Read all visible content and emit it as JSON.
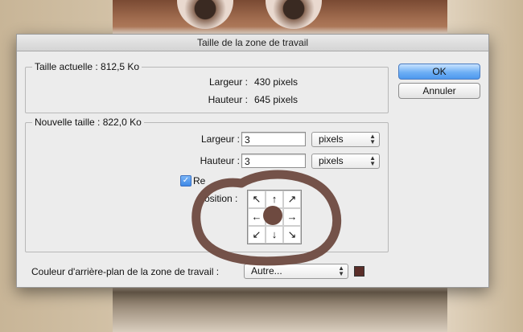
{
  "dialog": {
    "title": "Taille de la zone de travail",
    "ok_label": "OK",
    "cancel_label": "Annuler"
  },
  "current_size": {
    "title": "Taille actuelle : 812,5 Ko",
    "width_label": "Largeur :",
    "width_value": "430 pixels",
    "height_label": "Hauteur :",
    "height_value": "645 pixels"
  },
  "new_size": {
    "title": "Nouvelle taille : 822,0 Ko",
    "width_label": "Largeur :",
    "width_value": "3",
    "width_unit": "pixels",
    "height_label": "Hauteur :",
    "height_value": "3",
    "height_unit": "pixels",
    "relative_label": "Re",
    "relative_checked": true,
    "position_label": "osition :",
    "anchor_arrows": [
      "↖",
      "↑",
      "↗",
      "←",
      "",
      "→",
      "↙",
      "↓",
      "↘"
    ]
  },
  "background": {
    "label": "Couleur d'arrière-plan de la zone de travail :",
    "value": "Autre...",
    "swatch_color": "#5a2d28"
  },
  "annotation_color": "#6e4a40"
}
